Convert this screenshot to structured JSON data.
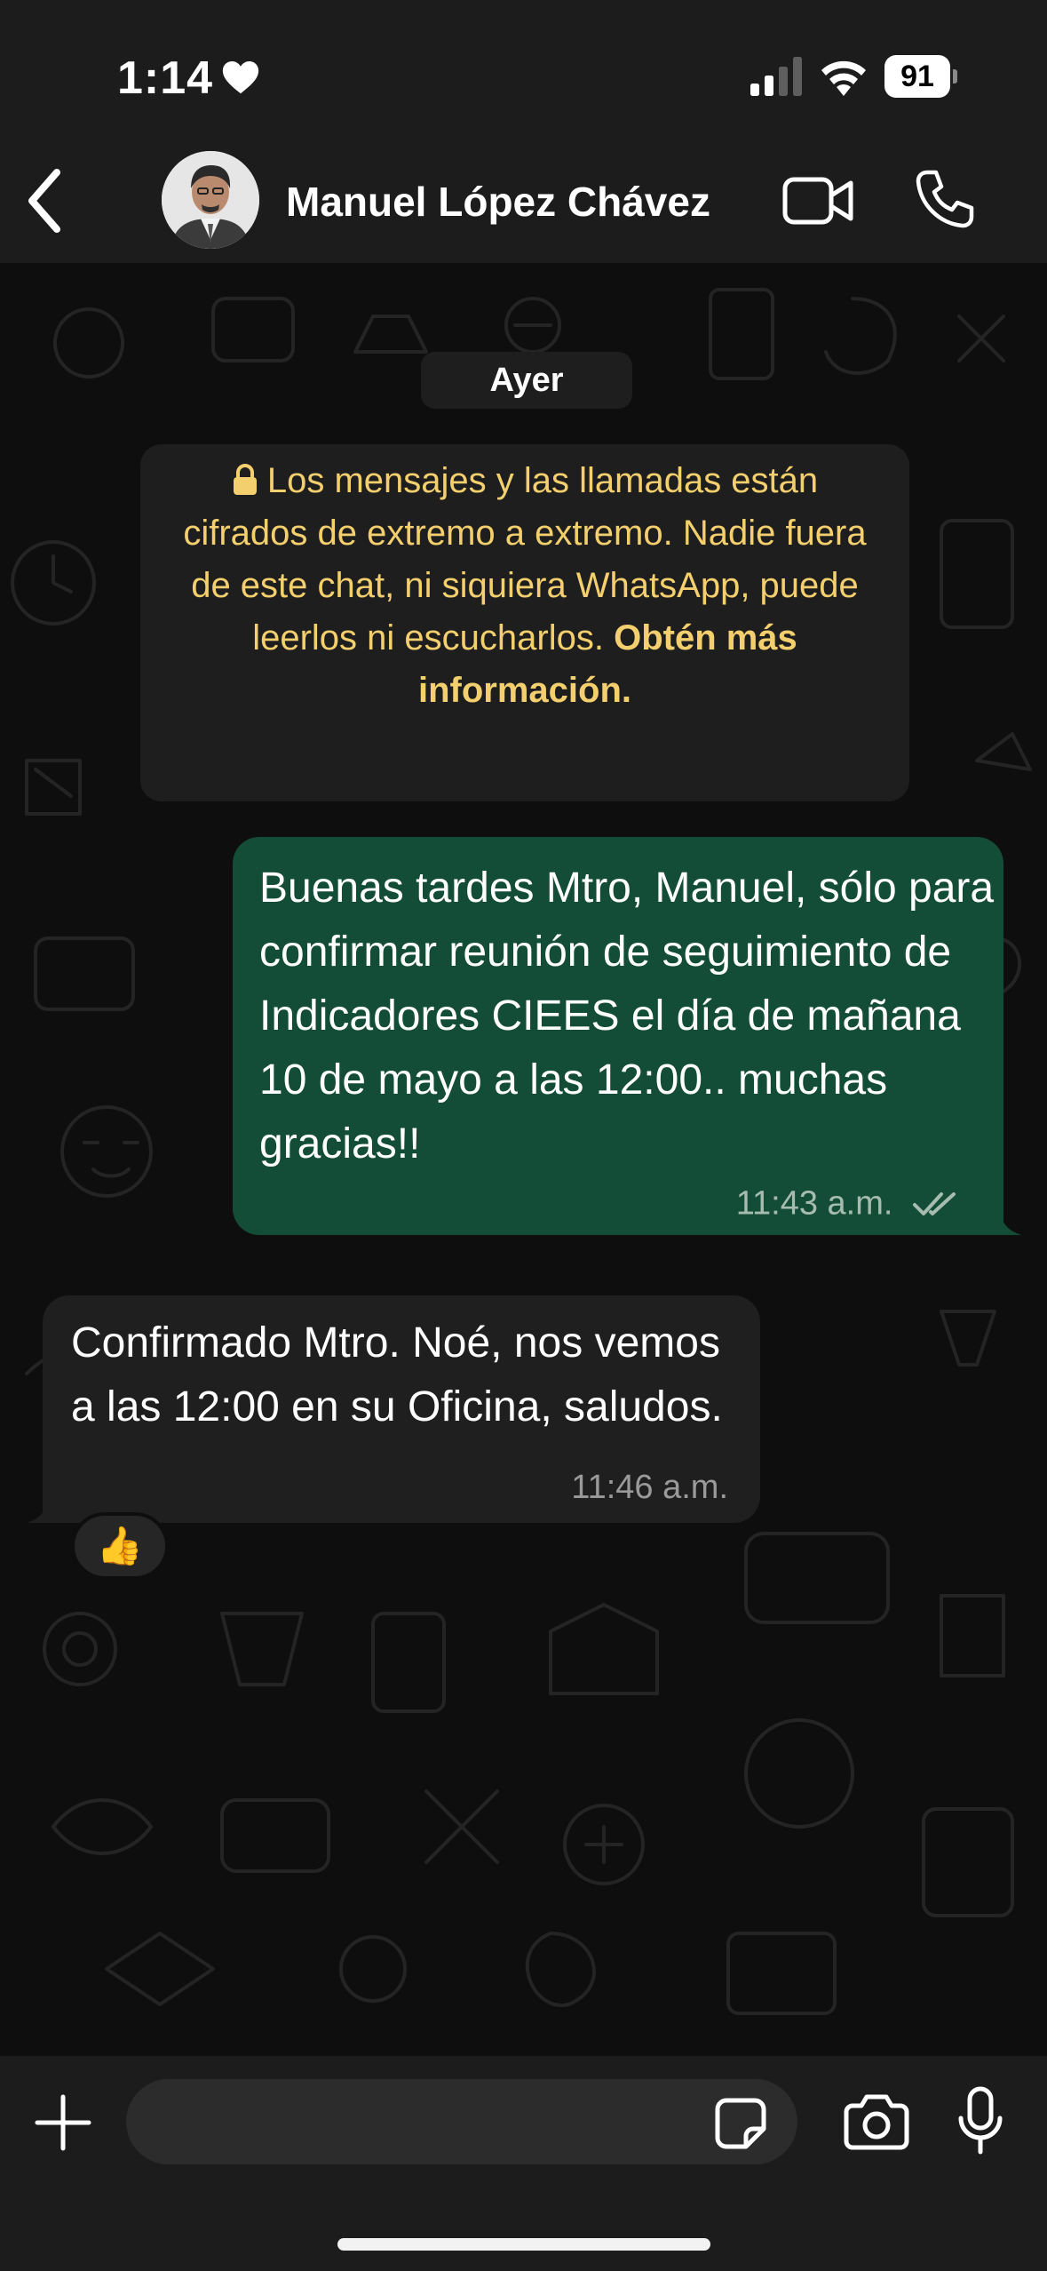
{
  "status_bar": {
    "time": "1:14",
    "heart_icon": "heart-icon",
    "signal_icon": "cellular-signal-icon",
    "wifi_icon": "wifi-icon",
    "battery_level": "91"
  },
  "header": {
    "back_icon": "chevron-left-icon",
    "contact_name": "Manuel López Chávez",
    "video_icon": "video-camera-icon",
    "phone_icon": "phone-icon"
  },
  "chat": {
    "day_label": "Ayer",
    "encryption_notice": {
      "icon": "lock-icon",
      "text": "Los mensajes y las llamadas están cifrados de extremo a extremo. Nadie fuera de este chat, ni siquiera WhatsApp, puede leerlos ni escucharlos.",
      "link_text": "Obtén más información."
    },
    "messages": [
      {
        "direction": "outgoing",
        "text": "Buenas tardes Mtro, Manuel, sólo para confirmar reunión de seguimiento de Indicadores CIEES el día de mañana 10 de mayo a las 12:00.. muchas gracias!!",
        "time": "11:43 a.m.",
        "status_icon": "double-check-icon"
      },
      {
        "direction": "incoming",
        "text": "Confirmado Mtro. Noé, nos vemos a las 12:00 en su Oficina, saludos.",
        "time": "11:46 a.m.",
        "reaction": "👍"
      }
    ]
  },
  "input_bar": {
    "plus_icon": "plus-icon",
    "message_value": "",
    "message_placeholder": "",
    "sticker_icon": "sticker-icon",
    "camera_icon": "camera-icon",
    "mic_icon": "microphone-icon"
  },
  "colors": {
    "outgoing_bubble": "#144d37",
    "incoming_bubble": "#1f1f1f",
    "notice_text": "#f4cf6e",
    "bar_background": "#1c1c1c"
  }
}
